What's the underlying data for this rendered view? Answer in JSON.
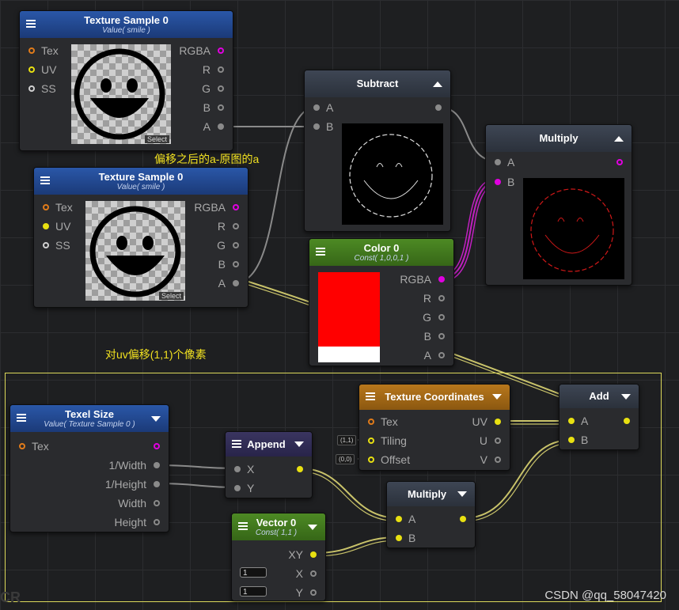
{
  "colors": {
    "port_orange": "#e07b1a",
    "port_yellow": "#e8e011",
    "port_white": "#d0d0d0",
    "port_gray": "#8a8a8a",
    "port_magenta": "#e000e0",
    "wire_yellow": "#c9c36a",
    "wire_magenta": "#c020c0",
    "wire_gray": "#8a8a8a"
  },
  "nodes": {
    "tex1": {
      "title": "Texture Sample 0",
      "subtitle": "Value( smile )",
      "inputs": [
        "Tex",
        "UV",
        "SS"
      ],
      "outputs": [
        "RGBA",
        "R",
        "G",
        "B",
        "A"
      ],
      "select": "Select"
    },
    "tex2": {
      "title": "Texture Sample 0",
      "subtitle": "Value( smile )",
      "inputs": [
        "Tex",
        "UV",
        "SS"
      ],
      "outputs": [
        "RGBA",
        "R",
        "G",
        "B",
        "A"
      ],
      "select": "Select"
    },
    "subtract": {
      "title": "Subtract",
      "inputs": [
        "A",
        "B"
      ]
    },
    "multiply1": {
      "title": "Multiply",
      "inputs": [
        "A",
        "B"
      ]
    },
    "color0": {
      "title": "Color 0",
      "subtitle": "Const( 1,0,0,1 )",
      "outputs": [
        "RGBA",
        "R",
        "G",
        "B",
        "A"
      ]
    },
    "add": {
      "title": "Add",
      "inputs": [
        "A",
        "B"
      ]
    },
    "texcoord": {
      "title": "Texture Coordinates",
      "inputs": [
        "Tex",
        "Tiling",
        "Offset"
      ],
      "outputs": [
        "UV",
        "U",
        "V"
      ],
      "tiling_val": "(1,1)",
      "offset_val": "(0,0)"
    },
    "texelsize": {
      "title": "Texel Size",
      "subtitle": "Value( Texture Sample 0 )",
      "inputs": [
        "Tex"
      ],
      "outputs": [
        "1/Width",
        "1/Height",
        "Width",
        "Height"
      ]
    },
    "append": {
      "title": "Append",
      "inputs": [
        "X",
        "Y"
      ]
    },
    "multiply2": {
      "title": "Multiply",
      "inputs": [
        "A",
        "B"
      ]
    },
    "vector0": {
      "title": "Vector 0",
      "subtitle": "Const( 1,1 )",
      "outputs": [
        "XY",
        "X",
        "Y"
      ],
      "x_val": "1",
      "y_val": "1"
    }
  },
  "annotations": {
    "subtract_note": "偏移之后的a-原图的a",
    "uv_note": "对uv偏移(1,1)个像素"
  },
  "footer": {
    "watermark": "CSDN @qq_58047420",
    "corner_text": "CR"
  }
}
